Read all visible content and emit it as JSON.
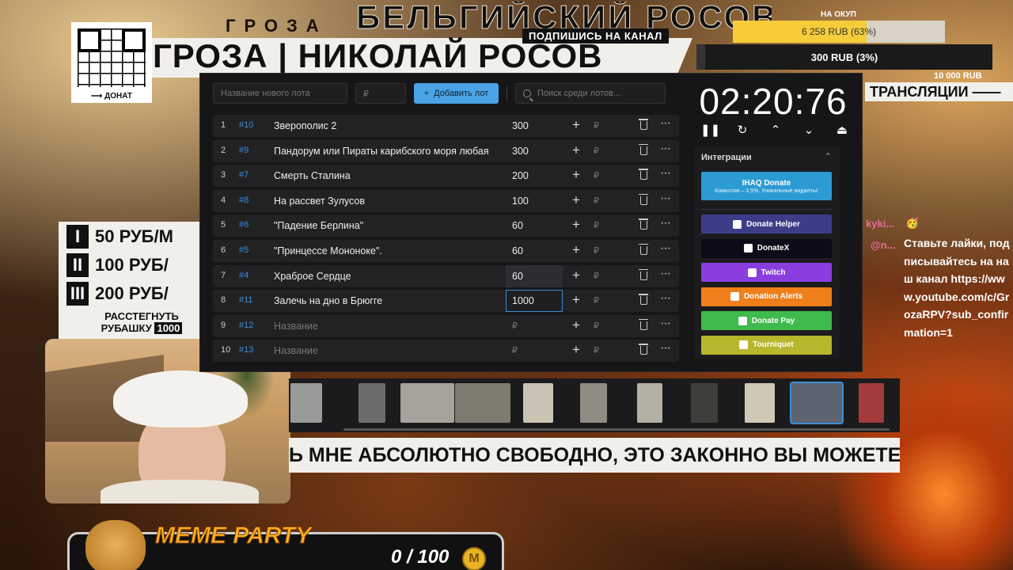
{
  "header": {
    "small_title": "ГРОЗА",
    "big_title": "БЕЛЬГИЙСКИЙ РОСОВ",
    "channel_title": "ГРОЗА | НИКОЛАЙ РОСОВ",
    "subscribe_label": "ПОДПИШИСЬ НА КАНАЛ",
    "qr_caption": "⟶ ДОНАТ"
  },
  "goals": {
    "label": "НА ОКУП",
    "goal1": {
      "text": "6 258 RUB (63%)",
      "progress": 0.63
    },
    "goal2": {
      "text": "300 RUB (3%)",
      "progress": 0.03
    },
    "goal3_label": "10 000 RUB",
    "broadcast_label": "ТРАНСЛЯЦИИ ——"
  },
  "price_list": {
    "items": [
      {
        "roman": "I",
        "price": "50 РУБ/М"
      },
      {
        "roman": "II",
        "price": "100 РУБ/"
      },
      {
        "roman": "III",
        "price": "200 РУБ/"
      }
    ],
    "rip_line1": "РАССТЕГНУТЬ",
    "rip_line2": "РУБАШКУ",
    "rip_amount": "1000"
  },
  "toolbar": {
    "new_lot_placeholder": "Название нового лота",
    "amount_placeholder": "₽",
    "add_button": "Добавить лот",
    "add_icon": "+",
    "search_placeholder": "Поиск среди лотов..."
  },
  "lots": [
    {
      "idx": "1",
      "num": "#10",
      "title": "Зверополис 2",
      "amount": "300"
    },
    {
      "idx": "2",
      "num": "#9",
      "title": "Пандорум или Пираты карибского моря любая",
      "amount": "300"
    },
    {
      "idx": "3",
      "num": "#7",
      "title": "Смерть Сталина",
      "amount": "200"
    },
    {
      "idx": "4",
      "num": "#8",
      "title": "На рассвет Зулусов",
      "amount": "100"
    },
    {
      "idx": "5",
      "num": "#6",
      "title": "\"Падение Берлина\"",
      "amount": "60"
    },
    {
      "idx": "6",
      "num": "#5",
      "title": "\"Принцессе Мононоке\".",
      "amount": "60"
    },
    {
      "idx": "7",
      "num": "#4",
      "title": "Храброе Сердце",
      "amount": "60"
    },
    {
      "idx": "8",
      "num": "#11",
      "title": "Залечь на дно в Брюгге",
      "amount": "1000"
    },
    {
      "idx": "9",
      "num": "#12",
      "title": "Название",
      "amount": "₽"
    },
    {
      "idx": "10",
      "num": "#13",
      "title": "Название",
      "amount": "₽"
    }
  ],
  "lot_ui": {
    "plus": "+",
    "currency": "₽",
    "more": "···"
  },
  "timer": {
    "value": "02:20:76"
  },
  "controls": {
    "pause": "❚❚",
    "reset": "↻",
    "up": "⌃",
    "down": "⌄",
    "top": "⏏"
  },
  "integrations": {
    "title": "Интеграции",
    "collapse_icon": "⌃",
    "ihaq": {
      "label": "IHAQ Donate",
      "sub": "Комиссия – 3,5%. Уникальные виджеты!"
    },
    "buttons": [
      {
        "label": "Donate Helper",
        "color": "#3c3c88"
      },
      {
        "label": "DonateX",
        "color": "#0c0c18"
      },
      {
        "label": "Twitch",
        "color": "#8a3ee0"
      },
      {
        "label": "Donation Alerts",
        "color": "#ef7f1a"
      },
      {
        "label": "Donate Pay",
        "color": "#3fba4c"
      },
      {
        "label": "Tourniquet",
        "color": "#b7b72d"
      }
    ]
  },
  "subtitle": "Ь МНЕ АБСОЛЮТНО СВОБОДНО, ЭТО ЗАКОННО ВЫ МОЖЕТЕ",
  "chat": {
    "name1": "kyki...",
    "emoji": "🥳",
    "name2": "@n...",
    "message": "Ставьте лайки, подписывайтесь на наш канал https://www.youtube.com/c/GrozaRPV?sub_confirmation=1"
  },
  "meme_party": {
    "title": "MEME PARTY",
    "count": "0 / 100",
    "coin": "M"
  }
}
